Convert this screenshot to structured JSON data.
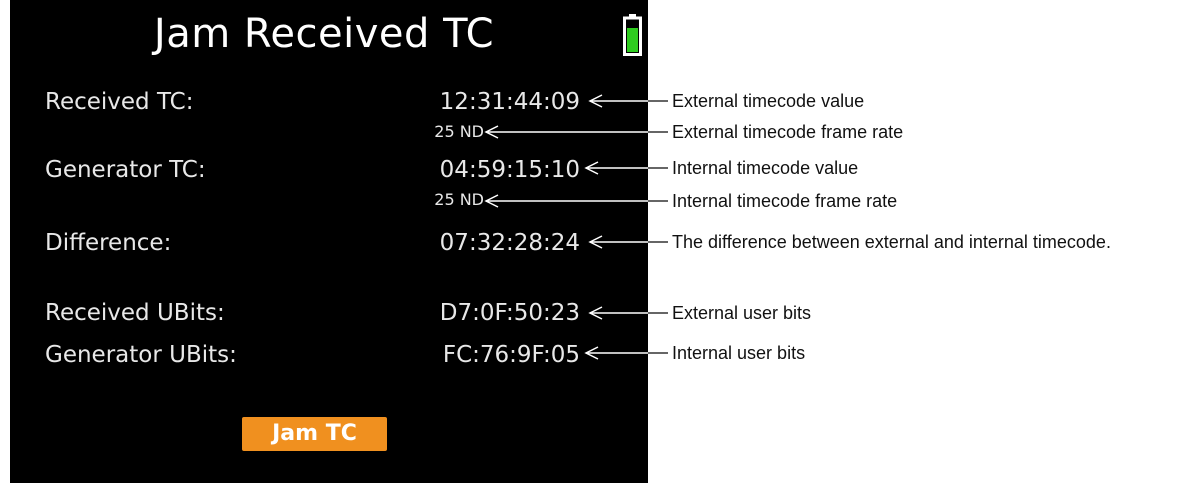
{
  "screen": {
    "title": "Jam Received TC",
    "battery_color": "#2ecc1f",
    "rows": {
      "received_tc": {
        "label": "Received TC:",
        "value": "12:31:44:09",
        "rate": "25 ND"
      },
      "generator_tc": {
        "label": "Generator TC:",
        "value": "04:59:15:10",
        "rate": "25 ND"
      },
      "difference": {
        "label": "Difference:",
        "value": "07:32:28:24"
      },
      "received_ubits": {
        "label": "Received UBits:",
        "value": "D7:0F:50:23"
      },
      "generator_ubits": {
        "label": "Generator UBits:",
        "value": "FC:76:9F:05"
      }
    },
    "jam_button": {
      "label": "Jam TC",
      "color": "#f0901f"
    }
  },
  "annotations": [
    "External timecode value",
    "External timecode frame rate",
    "Internal timecode value",
    "Internal timecode frame rate",
    "The difference between external and internal timecode.",
    "External user bits",
    "Internal user bits"
  ]
}
